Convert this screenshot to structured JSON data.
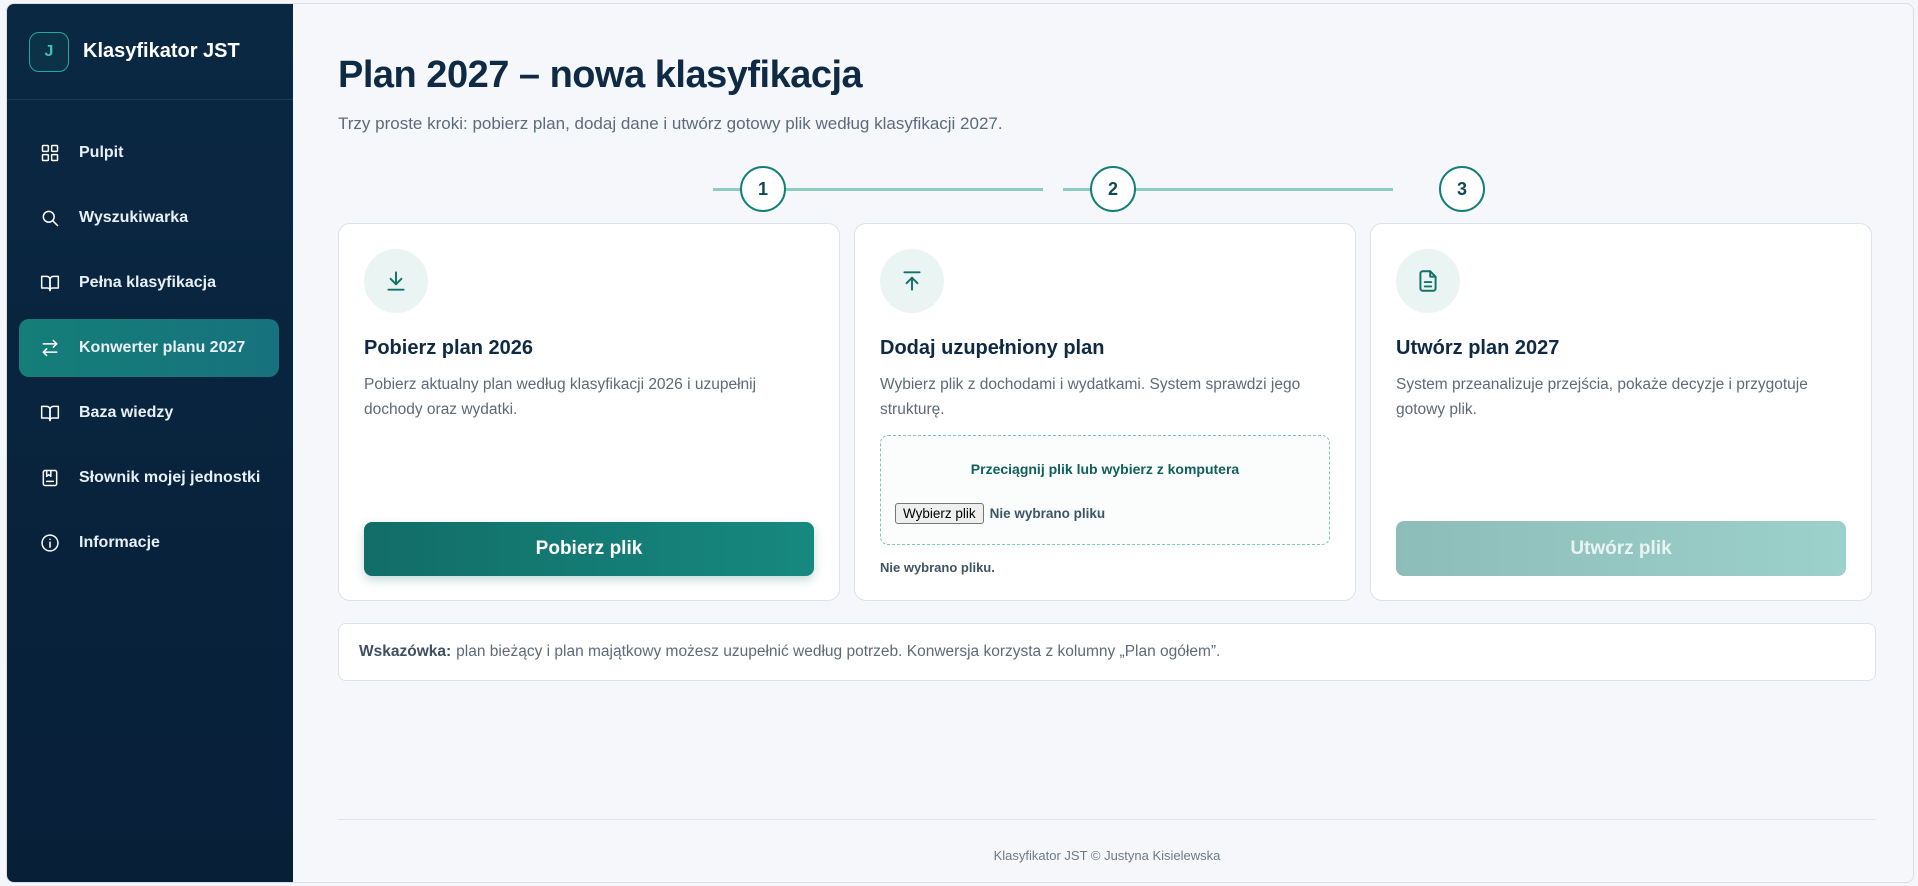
{
  "app": {
    "logo_letter": "J",
    "name": "Klasyfikator JST"
  },
  "sidebar": {
    "items": [
      {
        "label": "Pulpit",
        "icon": "grid-icon",
        "active": false
      },
      {
        "label": "Wyszukiwarka",
        "icon": "search-icon",
        "active": false
      },
      {
        "label": "Pełna klasyfikacja",
        "icon": "book-open-icon",
        "active": false
      },
      {
        "label": "Konwerter planu 2027",
        "icon": "arrows-swap-icon",
        "active": true
      },
      {
        "label": "Baza wiedzy",
        "icon": "book-open-icon",
        "active": false
      },
      {
        "label": "Słownik mojej jednostki",
        "icon": "notebook-icon",
        "active": false
      },
      {
        "label": "Informacje",
        "icon": "info-icon",
        "active": false
      }
    ]
  },
  "page": {
    "title": "Plan 2027 – nowa klasyfikacja",
    "subtitle": "Trzy proste kroki: pobierz plan, dodaj dane i utwórz gotowy plik według klasyfikacji 2027."
  },
  "steps": [
    "1",
    "2",
    "3"
  ],
  "cards": [
    {
      "icon": "download-icon",
      "title": "Pobierz plan 2026",
      "description": "Pobierz aktualny plan według klasyfikacji 2026 i uzupełnij dochody oraz wydatki.",
      "button_label": "Pobierz plik"
    },
    {
      "icon": "upload-icon",
      "title": "Dodaj uzupełniony plan",
      "description": "Wybierz plik z dochodami i wydatkami. System sprawdzi jego strukturę.",
      "dropzone_label": "Przeciągnij plik lub wybierz z komputera",
      "file_button_label": "Wybierz plik",
      "file_status": "Nie wybrano pliku",
      "file_note": "Nie wybrano pliku."
    },
    {
      "icon": "document-icon",
      "title": "Utwórz plan 2027",
      "description": "System przeanalizuje przejścia, pokaże decyzje i przygotuje gotowy plik.",
      "button_label": "Utwórz plik",
      "button_disabled": true
    }
  ],
  "hint": {
    "label": "Wskazówka:",
    "text": "plan bieżący i plan majątkowy możesz uzupełnić według potrzeb. Konwersja korzysta z kolumny „Plan ogółem”."
  },
  "footer": {
    "text": "Klasyfikator JST © Justyna Kisielewska"
  },
  "colors": {
    "sidebar_bg": "#0a2842",
    "accent": "#137f78",
    "active_nav": "#157e78",
    "disabled_button": "#9bd0cb"
  }
}
